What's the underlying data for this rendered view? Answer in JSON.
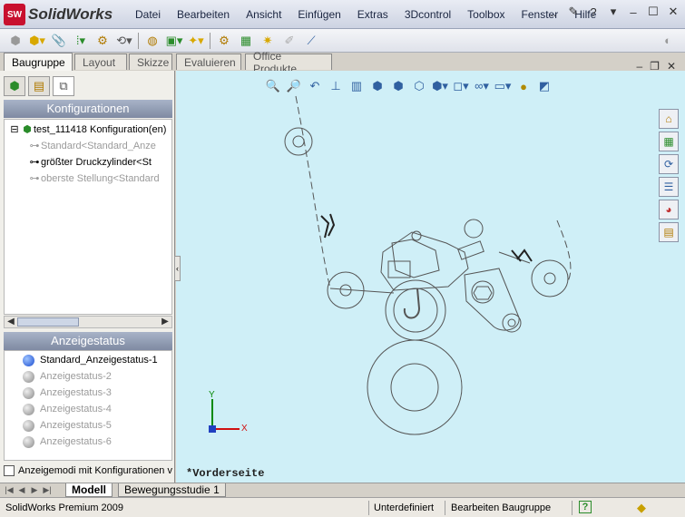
{
  "app": {
    "logo_badge": "SW",
    "logo_text": "SolidWorks"
  },
  "menu": [
    "Datei",
    "Bearbeiten",
    "Ansicht",
    "Einfügen",
    "Extras",
    "3Dcontrol",
    "Toolbox",
    "Fenster",
    "Hilfe"
  ],
  "menu_more": "..",
  "window_controls": {
    "help": "?",
    "minimize": "–",
    "maximize": "☐",
    "close": "✕"
  },
  "tabs": [
    "Baugruppe",
    "Layout",
    "Skizze",
    "Evaluieren",
    "Office Produkte"
  ],
  "tab_controls": {
    "minimize": "–",
    "restore": "❐",
    "close": "✕"
  },
  "panel": {
    "config_header": "Konfigurationen",
    "tree_root": "test_111418 Konfiguration(en)",
    "configs": [
      "Standard<Standard_Anze",
      "größter Druckzylinder<St",
      "oberste Stellung<Standard"
    ],
    "state_header": "Anzeigestatus",
    "states": [
      "Standard_Anzeigestatus-1",
      "Anzeigestatus-2",
      "Anzeigestatus-3",
      "Anzeigestatus-4",
      "Anzeigestatus-5",
      "Anzeigestatus-6"
    ],
    "checkbox_label": "Anzeigemodi mit Konfigurationen ve"
  },
  "viewport": {
    "view_label": "*Vorderseite",
    "axis_x": "X",
    "axis_y": "Y"
  },
  "bottom_tabs": [
    "Modell",
    "Bewegungsstudie 1"
  ],
  "status": {
    "product": "SolidWorks Premium 2009",
    "state": "Unterdefiniert",
    "mode": "Bearbeiten Baugruppe",
    "help": "?"
  },
  "colors": {
    "viewport_bg": "#cfeff7",
    "header_bg": "#7f8aa2",
    "logo_red": "#c8102e"
  }
}
